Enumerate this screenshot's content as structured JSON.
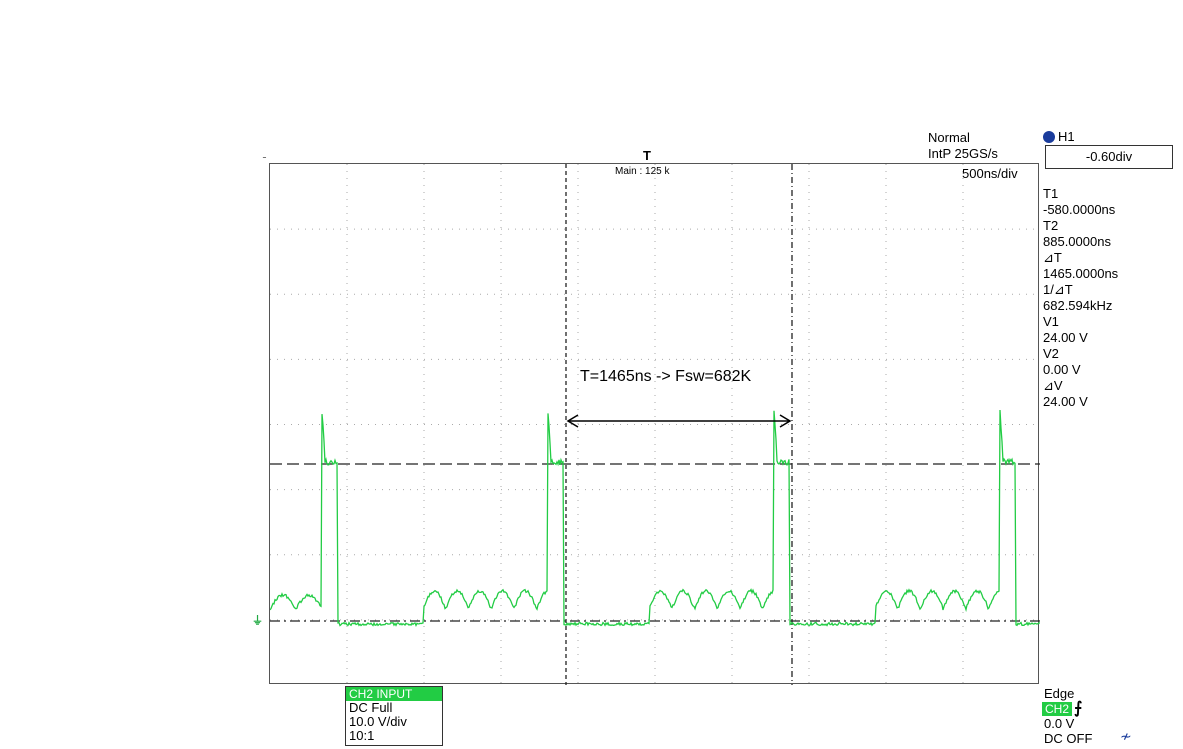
{
  "header": {
    "acq_mode": "Normal",
    "sample_rate": "IntP  25GS/s",
    "timebase": "500ns/div",
    "zoom_label": "Main : 125 k",
    "trigger_marker": "T"
  },
  "h1": {
    "label": "H1",
    "value": "-0.60div"
  },
  "cursors": {
    "t1_label": "T1",
    "t1_value": "-580.0000ns",
    "t2_label": "T2",
    "t2_value": "885.0000ns",
    "dt_label": "⊿T",
    "dt_value": "1465.0000ns",
    "inv_dt_label": "1/⊿T",
    "inv_dt_value": "682.594kHz",
    "v1_label": "V1",
    "v1_value": "24.00 V",
    "v2_label": "V2",
    "v2_value": "0.00 V",
    "dv_label": "⊿V",
    "dv_value": "24.00 V"
  },
  "annotation": {
    "text": "T=1465ns -> Fsw=682K"
  },
  "ch2_panel": {
    "title": "CH2 INPUT",
    "coupling": "DC Full",
    "scale": "10.0 V/div",
    "probe": "10:1"
  },
  "trigger": {
    "mode": "Edge",
    "source": "CH2",
    "level": "0.0 V",
    "coupling": "DC OFF"
  },
  "colors": {
    "trace": "#22cc44",
    "badge": "#22cc44"
  }
}
